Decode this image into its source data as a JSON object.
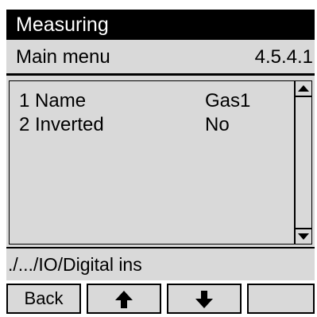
{
  "title_bar": {
    "title": "Measuring"
  },
  "menu_bar": {
    "title": "Main menu",
    "code": "4.5.4.1"
  },
  "parameters": [
    {
      "label": "1 Name",
      "value": "Gas1"
    },
    {
      "label": "2 Inverted",
      "value": "No"
    }
  ],
  "scrollbar": {
    "up_icon": "triangle-up-icon",
    "down_icon": "triangle-down-icon"
  },
  "path": {
    "text": "./.../IO/Digital ins"
  },
  "softkeys": {
    "back_label": "Back",
    "up_icon": "arrow-up-icon",
    "down_icon": "arrow-down-icon",
    "empty_label": ""
  },
  "colors": {
    "background": "#d9d9d9",
    "title_bar": "#000000",
    "title_text": "#ffffff"
  }
}
